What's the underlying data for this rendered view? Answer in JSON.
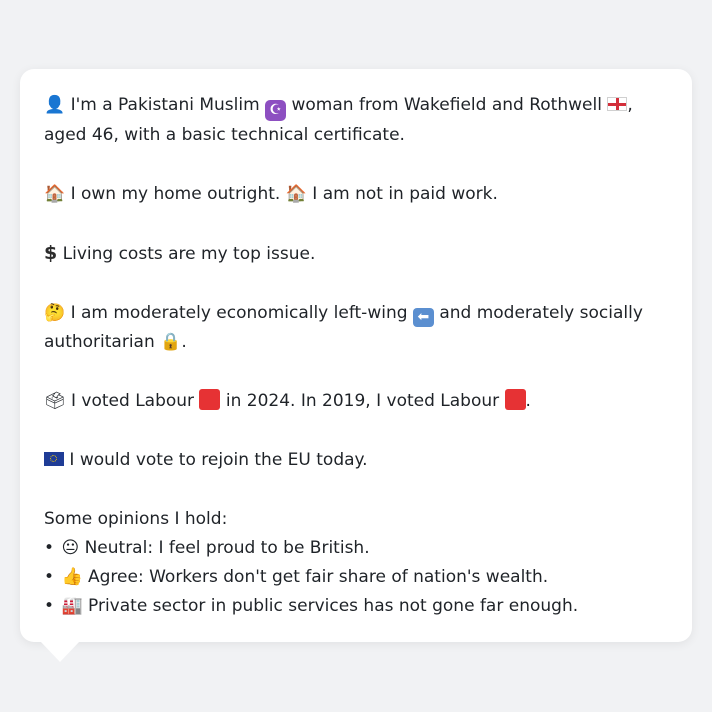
{
  "profile": {
    "intro_person_emoji": "👤",
    "intro_part1": "I'm a Pakistani Muslim",
    "intro_religion_emoji": "☪",
    "intro_part2": "woman from Wakefield and Rothwell",
    "intro_part3": ", aged 46, with a basic technical certificate.",
    "home_emoji": "🏠",
    "home_text": "I own my home outright.",
    "work_emoji": "🏠",
    "work_text": "I am not in paid work.",
    "issue_emoji": "$",
    "issue_text": "Living costs are my top issue.",
    "ideology_emoji": "🤔",
    "ideology_part1": "I am moderately economically left-wing",
    "ideology_arrow": "⬅",
    "ideology_part2": "and moderately socially authoritarian",
    "ideology_lock_emoji": "🔒",
    "ideology_end": ".",
    "vote_emoji": "🗳",
    "vote_part1": "I voted Labour",
    "vote_part2": "in 2024. In 2019, I voted Labour",
    "vote_end": ".",
    "eu_text": "I would vote to rejoin the EU today.",
    "opinions_heading": "Some opinions I hold:",
    "opinions": [
      {
        "bullet": "•",
        "emoji": "😐",
        "text": "Neutral: I feel proud to be British."
      },
      {
        "bullet": "•",
        "emoji": "👍",
        "text": "Agree: Workers don't get fair share of nation's wealth."
      },
      {
        "bullet": "•",
        "emoji": "🏭",
        "text": "Private sector in public services has not gone far enough."
      }
    ]
  },
  "colors": {
    "background": "#f1f2f4",
    "bubble": "#ffffff",
    "text": "#1f2328",
    "labour_red": "#e63234",
    "eu_blue": "#1f3c96"
  }
}
